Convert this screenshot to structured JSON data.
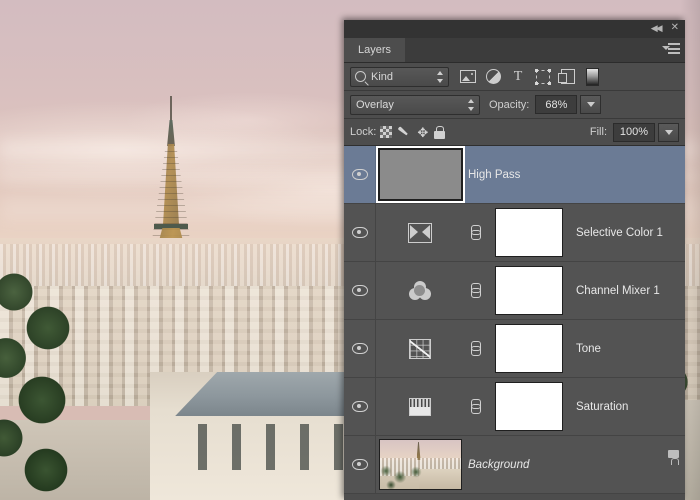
{
  "window": {
    "background_image_alt": "Paris skyline at sunset with the Eiffel Tower"
  },
  "panel": {
    "title": "Layers",
    "titlebar": {
      "collapse_icon": "collapse-to-icons-icon",
      "collapse_glyph": "◀◀",
      "close_icon": "close-icon",
      "close_glyph": "✕",
      "menu_icon": "panel-menu-icon"
    },
    "filter": {
      "kind_label": "Kind",
      "search_icon": "search-icon",
      "stepper_icon": "updown-stepper-icon",
      "types": [
        {
          "name": "filter-pixel-layers-icon",
          "title": "Pixel layers"
        },
        {
          "name": "filter-adjustment-layers-icon",
          "title": "Adjustment layers"
        },
        {
          "name": "filter-type-layers-icon",
          "title": "Type layers",
          "glyph": "T"
        },
        {
          "name": "filter-shape-layers-icon",
          "title": "Shape layers"
        },
        {
          "name": "filter-smart-objects-icon",
          "title": "Smart objects"
        }
      ],
      "toggle_icon": "filter-enable-toggle-icon"
    },
    "blend": {
      "mode": "Overlay",
      "opacity_label": "Opacity:",
      "opacity_value": "68%"
    },
    "lock": {
      "label": "Lock:",
      "icons": [
        {
          "name": "lock-transparent-pixels-icon"
        },
        {
          "name": "lock-image-pixels-icon"
        },
        {
          "name": "lock-position-icon",
          "glyph": "✥"
        },
        {
          "name": "lock-all-icon"
        }
      ],
      "fill_label": "Fill:",
      "fill_value": "100%"
    },
    "layers": [
      {
        "name": "High Pass",
        "kind": "smart-object",
        "selected": true,
        "visible": true,
        "italic": false,
        "locked": false,
        "thumb": "gray-smart-object-thumbnail",
        "has_mask": false,
        "has_link": false
      },
      {
        "name": "Selective Color 1",
        "kind": "adjustment",
        "adjustment_icon": "selective-color-icon",
        "selected": false,
        "visible": true,
        "italic": false,
        "locked": false,
        "has_mask": true,
        "has_link": true
      },
      {
        "name": "Channel Mixer 1",
        "kind": "adjustment",
        "adjustment_icon": "channel-mixer-icon",
        "selected": false,
        "visible": true,
        "italic": false,
        "locked": false,
        "has_mask": true,
        "has_link": true
      },
      {
        "name": "Tone",
        "kind": "adjustment",
        "adjustment_icon": "curves-icon",
        "selected": false,
        "visible": true,
        "italic": false,
        "locked": false,
        "has_mask": true,
        "has_link": true
      },
      {
        "name": "Saturation",
        "kind": "adjustment",
        "adjustment_icon": "hue-saturation-icon",
        "selected": false,
        "visible": true,
        "italic": false,
        "locked": false,
        "has_mask": true,
        "has_link": true
      },
      {
        "name": "Background",
        "kind": "image",
        "selected": false,
        "visible": true,
        "italic": true,
        "locked": true,
        "thumb": "paris-photo-thumbnail",
        "has_mask": false,
        "has_link": false
      }
    ],
    "colors": {
      "panel_bg": "#4d4d4d",
      "row_bg": "#535353",
      "selected_row": "#6b7b95",
      "text": "#e7e7e7"
    }
  }
}
